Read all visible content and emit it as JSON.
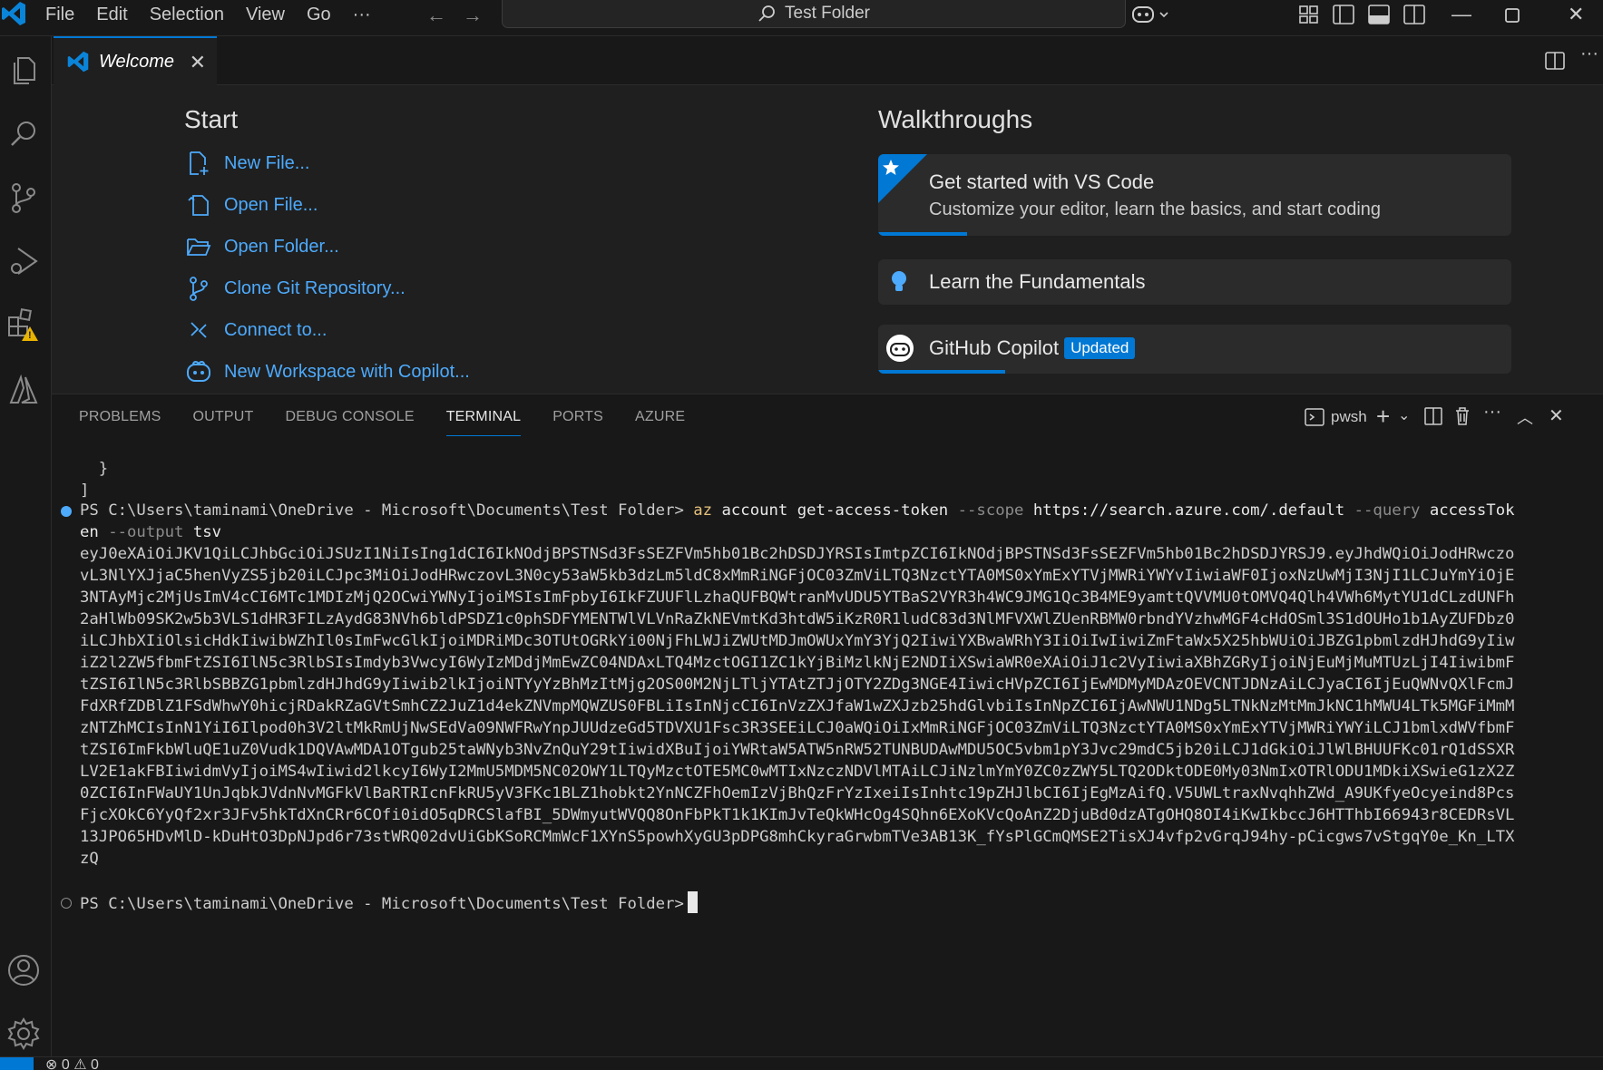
{
  "menu": [
    "File",
    "Edit",
    "Selection",
    "View",
    "Go",
    "···"
  ],
  "command_center": {
    "label": "Test Folder"
  },
  "editor": {
    "tab_label": "Welcome",
    "start": {
      "title": "Start",
      "items": [
        "New File...",
        "Open File...",
        "Open Folder...",
        "Clone Git Repository...",
        "Connect to...",
        "New Workspace with Copilot..."
      ]
    },
    "walkthroughs": {
      "title": "Walkthroughs",
      "items": [
        {
          "title": "Get started with VS Code",
          "description": "Customize your editor, learn the basics, and start coding",
          "progress": 0.14
        },
        {
          "title": "Learn the Fundamentals",
          "progress": 0
        },
        {
          "title": "GitHub Copilot",
          "badge": "Updated",
          "progress": 0.2
        }
      ]
    }
  },
  "panel": {
    "tabs": [
      "PROBLEMS",
      "OUTPUT",
      "DEBUG CONSOLE",
      "TERMINAL",
      "PORTS",
      "AZURE"
    ],
    "active_tab": "TERMINAL",
    "shell": "pwsh"
  },
  "terminal": {
    "lines": [
      "  }",
      "]"
    ],
    "prompt": "PS C:\\Users\\taminami\\OneDrive - Microsoft\\Documents\\Test Folder>",
    "command": {
      "exe": "az",
      "args1": "account get-access-token",
      "flag1": "--scope",
      "val1": "https://search.azure.com/.default",
      "flag2": "--query",
      "val2_part1": "accessTok",
      "val2_part2": "en",
      "flag3": "--output",
      "val3": "tsv"
    },
    "token_lines": [
      "eyJ0eXAiOiJKV1QiLCJhbGciOiJSUzI1NiIsIng1dCI6IkNOdjBPSTNSd3FsSEZFVm5hb01Bc2hDSDJYRSIsImtpZCI6IkNOdjBPSTNSd3FsSEZFVm5hb01Bc2hDSDJYRSJ9.eyJhdWQiOiJodHRwczo",
      "vL3NlYXJjaC5henVyZS5jb20iLCJpc3MiOiJodHRwczovL3N0cy53aW5kb3dzLm5ldC8xMmRiNGFjOC03ZmViLTQ3NzctYTA0MS0xYmExYTVjMWRiYWYvIiwiaWF0IjoxNzUwMjI3NjI1LCJuYmYiOjE",
      "3NTAyMjc2MjUsImV4cCI6MTc1MDIzMjQ2OCwiYWNyIjoiMSIsImFpbyI6IkFZUUFlLzhaQUFBQWtranMvUDU5YTBaS2VYR3h4WC9JMG1Qc3B4ME9yamttQVVMU0tOMVQ4Qlh4VWh6MytYU1dCLzdUNFh",
      "2aHlWb09SK2w5b3VLS1dHR3FILzAydG83NVh6bldPSDZ1c0phSDFYMENTWlVLVnRaZkNEVmtKd3htdW5iKzR0R1ludC83d3NlMFVXWlZUenRBMW0rbndYVzhwMGF4cHdOSml3S1dOUHo1b1AyZUFDbz0",
      "iLCJhbXIiOlsicHdkIiwibWZhIl0sImFwcGlkIjoiMDRiMDc3OTUtOGRkYi00NjFhLWJiZWUtMDJmOWUxYmY3YjQ2IiwiYXBwaWRhY3IiOiIwIiwiZmFtaWx5X25hbWUiOiJBZG1pbmlzdHJhdG9yIiw",
      "iZ2l2ZW5fbmFtZSI6IlN5c3RlbSIsImdyb3VwcyI6WyIzMDdjMmEwZC04NDAxLTQ4MzctOGI1ZC1kYjBiMzlkNjE2NDIiXSwiaWR0eXAiOiJ1c2VyIiwiaXBhZGRyIjoiNjEuMjMuMTUzLjI4IiwibmF",
      "tZSI6IlN5c3RlbSBBZG1pbmlzdHJhdG9yIiwib2lkIjoiNTYyYzBhMzItMjg2OS00M2NjLTljYTAtZTJjOTY2ZDg3NGE4IiwicHVpZCI6IjEwMDMyMDAzOEVCNTJDNzAiLCJyaCI6IjEuQWNvQXlFcmJ",
      "FdXRfZDBlZ1FSdWhwY0hicjRDakRZaGVtSmhCZ2JuZ1d4ekZNVmpMQWZUS0FBLiIsInNjcCI6InVzZXJfaW1wZXJzb25hdGlvbiIsInNpZCI6IjAwNWU1NDg5LTNkNzMtMmJkNC1hMWU4LTk5MGFiMmM",
      "zNTZhMCIsInN1YiI6Ilpod0h3V2ltMkRmUjNwSEdVa09NWFRwYnpJUUdzeGd5TDVXU1Fsc3R3SEEiLCJ0aWQiOiIxMmRiNGFjOC03ZmViLTQ3NzctYTA0MS0xYmExYTVjMWRiYWYiLCJ1bmlxdWVfbmF",
      "tZSI6ImFkbWluQE1uZ0Vudk1DQVAwMDA1OTgub25taWNyb3NvZnQuY29tIiwidXBuIjoiYWRtaW5ATW5nRW52TUNBUDAwMDU5OC5vbm1pY3Jvc29mdC5jb20iLCJ1dGkiOiJlWlBHUUFKc01rQ1dSSXR",
      "LV2E1akFBIiwidmVyIjoiMS4wIiwid2lkcyI6WyI2MmU5MDM5NC02OWY1LTQyMzctOTE5MC0wMTIxNzczNDVlMTAiLCJiNzlmYmY0ZC0zZWY5LTQ2ODktODE0My03NmIxOTRlODU1MDkiXSwieG1zX2Z",
      "0ZCI6InFWaUY1UnJqbkJVdnNvMGFkVlBaRTRIcnFkRU5yV3FKc1BLZ1hobkt2YnNCZFhOemIzVjBhQzFrYzIxeiIsInhtc19pZHJlbCI6IjEgMzAifQ.V5UWLtraxNvqhhZWd_A9UKfyeOcyeind8Pcs",
      "FjcXOkC6YyQf2xr3JFv5hkTdXnCRr6COfi0idO5qDRCSlafBI_5DWmyutWVQQ8OnFbPkT1k1KImJvTeQkWHcOg4SQhn6EXoKVcQoAnZ2DjuBd0dzATgOHQ8OI4iKwIkbccJ6HTThbI66943r8CEDRsVL",
      "13JPO65HDvMlD-kDuHtO3DpNJpd6r73stWRQ02dvUiGbKSoRCMmWcF1XYnS5powhXyGU3pDPG8mhCkyraGrwbmTVe3AB13K_fYsPlGCmQMSE2TisXJ4vfp2vGrqJ94hy-pCicgws7vStgqY0e_Kn_LTX",
      "zQ"
    ]
  },
  "status": {
    "problems": "0",
    "warnings": "0"
  },
  "colors": {
    "accent": "#0078d4",
    "link": "#4daafc",
    "command": "#e5c07b"
  }
}
